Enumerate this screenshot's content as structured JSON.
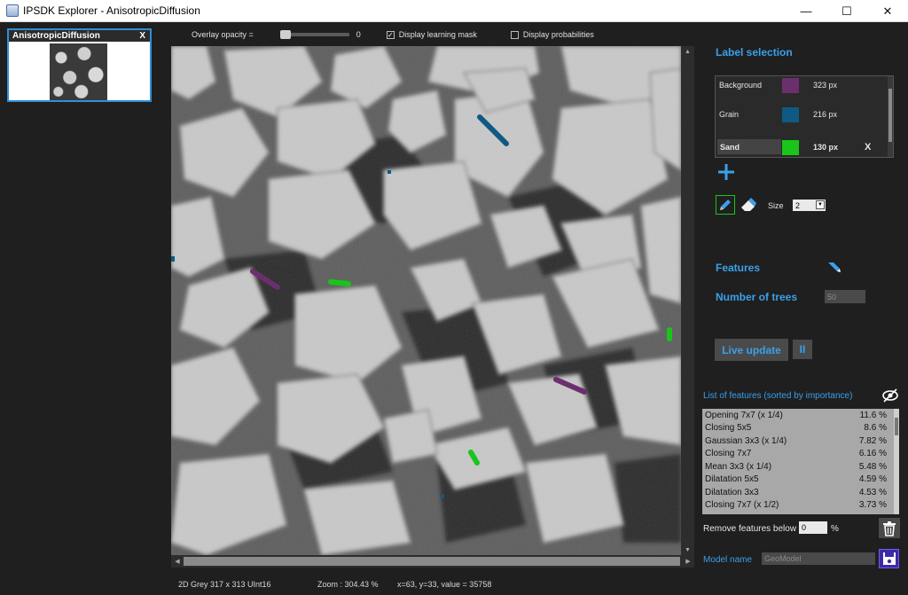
{
  "window": {
    "title": "IPSDK Explorer - AnisotropicDiffusion",
    "minimize": "—",
    "maximize": "☐",
    "close": "✕"
  },
  "thumbnail": {
    "title": "AnisotropicDiffusion",
    "close": "X"
  },
  "toolbar": {
    "opacity_label": "Overlay opacity =",
    "opacity_value": "0",
    "learning_mask_label": "Display learning mask",
    "learning_mask_checked": true,
    "probabilities_label": "Display probabilities",
    "probabilities_checked": false
  },
  "status": {
    "image_info": "2D Grey 317 x 313 UInt16",
    "zoom": "Zoom : 304.43 %",
    "cursor": "x=63, y=33, value = 35758"
  },
  "label_selection": {
    "title": "Label selection",
    "labels": [
      {
        "name": "Background",
        "color": "#6b2f6e",
        "count": "323 px"
      },
      {
        "name": "Grain",
        "color": "#0f5a84",
        "count": "216 px"
      },
      {
        "name": "Sand",
        "color": "#19c519",
        "count": "130 px",
        "delete": "X"
      }
    ],
    "size_label": "Size",
    "size_value": "2"
  },
  "features": {
    "title": "Features",
    "trees_label": "Number of trees",
    "trees_value": "50",
    "live_update": "Live update",
    "pause": "II",
    "list_title": "List of features (sorted by importance)",
    "items": [
      {
        "name": "Opening 7x7 (x 1/4)",
        "value": "11.6 %"
      },
      {
        "name": "Closing 5x5",
        "value": "8.6 %"
      },
      {
        "name": "Gaussian 3x3 (x 1/4)",
        "value": "7.82 %"
      },
      {
        "name": "Closing 7x7",
        "value": "6.16 %"
      },
      {
        "name": "Mean 3x3 (x 1/4)",
        "value": "5.48 %"
      },
      {
        "name": "Dilatation 5x5",
        "value": "4.59 %"
      },
      {
        "name": "Dilatation 3x3",
        "value": "4.53 %"
      },
      {
        "name": "Closing 7x7 (x 1/2)",
        "value": "3.73 %"
      }
    ],
    "remove_label": "Remove features below",
    "remove_value": "0",
    "remove_unit": "%",
    "model_label": "Model name",
    "model_value": "GeoModel"
  },
  "colors": {
    "accent": "#3aa0ea",
    "background_label": "#6b2f6e",
    "grain_label": "#0f5a84",
    "sand_label": "#19c519"
  }
}
